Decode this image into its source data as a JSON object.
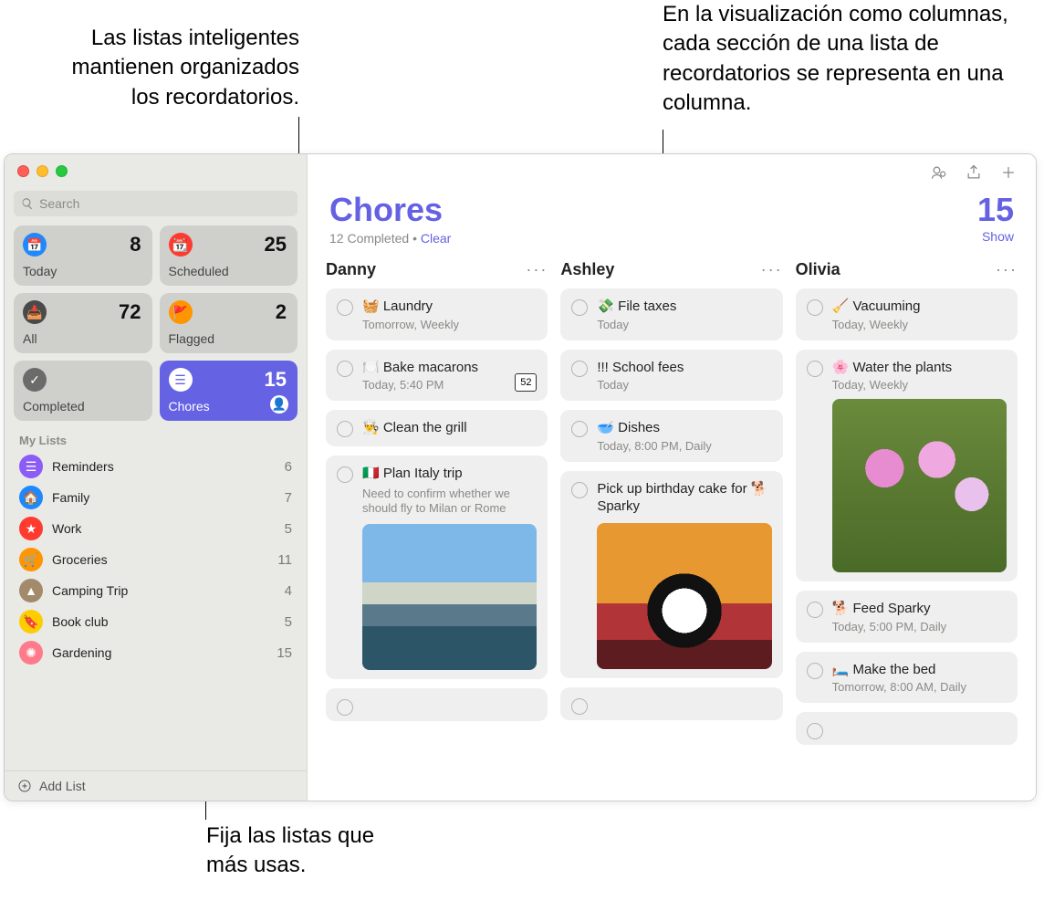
{
  "callouts": {
    "smart_lists": "Las listas inteligentes mantienen organizados los recordatorios.",
    "columns_view": "En la visualización como columnas, cada sección de una lista de recordatorios se representa en una columna.",
    "pin_lists": "Fija las listas que más usas."
  },
  "search_placeholder": "Search",
  "smart_cards": {
    "today": {
      "label": "Today",
      "count": "8"
    },
    "scheduled": {
      "label": "Scheduled",
      "count": "25"
    },
    "all": {
      "label": "All",
      "count": "72"
    },
    "flagged": {
      "label": "Flagged",
      "count": "2"
    },
    "completed": {
      "label": "Completed",
      "count": ""
    },
    "chores": {
      "label": "Chores",
      "count": "15"
    }
  },
  "my_lists_title": "My Lists",
  "my_lists": [
    {
      "name": "Reminders",
      "count": "6",
      "color": "#8b5cf6"
    },
    {
      "name": "Family",
      "count": "7",
      "color": "#1e88ff"
    },
    {
      "name": "Work",
      "count": "5",
      "color": "#ff3b30"
    },
    {
      "name": "Groceries",
      "count": "11",
      "color": "#ff9500"
    },
    {
      "name": "Camping Trip",
      "count": "4",
      "color": "#a28a6a"
    },
    {
      "name": "Book club",
      "count": "5",
      "color": "#ffcc00"
    },
    {
      "name": "Gardening",
      "count": "15",
      "color": "#ff7a8a"
    }
  ],
  "add_list_label": "Add List",
  "main": {
    "title": "Chores",
    "completed_text": "12 Completed",
    "clear_label": "Clear",
    "total_count": "15",
    "show_label": "Show"
  },
  "columns": [
    {
      "name": "Danny",
      "cards": [
        {
          "title": "🧺 Laundry",
          "sub": "Tomorrow, Weekly"
        },
        {
          "title": "🍽️ Bake macarons",
          "sub": "Today, 5:40 PM",
          "badge": "52"
        },
        {
          "title": "👨‍🍳 Clean the grill"
        },
        {
          "title": "🇮🇹 Plan Italy trip",
          "note": "Need to confirm whether we should fly to Milan or Rome",
          "image": "italy"
        }
      ]
    },
    {
      "name": "Ashley",
      "cards": [
        {
          "title": "💸 File taxes",
          "sub": "Today"
        },
        {
          "title": "!!! School fees",
          "sub": "Today"
        },
        {
          "title": "🥣 Dishes",
          "sub": "Today, 8:00 PM, Daily"
        },
        {
          "title": "Pick up birthday cake for 🐕 Sparky",
          "image": "dog"
        }
      ]
    },
    {
      "name": "Olivia",
      "cards": [
        {
          "title": "🧹 Vacuuming",
          "sub": "Today, Weekly"
        },
        {
          "title": "🌸 Water the plants",
          "sub": "Today, Weekly",
          "image": "flowers"
        },
        {
          "title": "🐕 Feed Sparky",
          "sub": "Today, 5:00 PM, Daily"
        },
        {
          "title": "🛏️ Make the bed",
          "sub": "Tomorrow, 8:00 AM, Daily"
        }
      ]
    }
  ]
}
